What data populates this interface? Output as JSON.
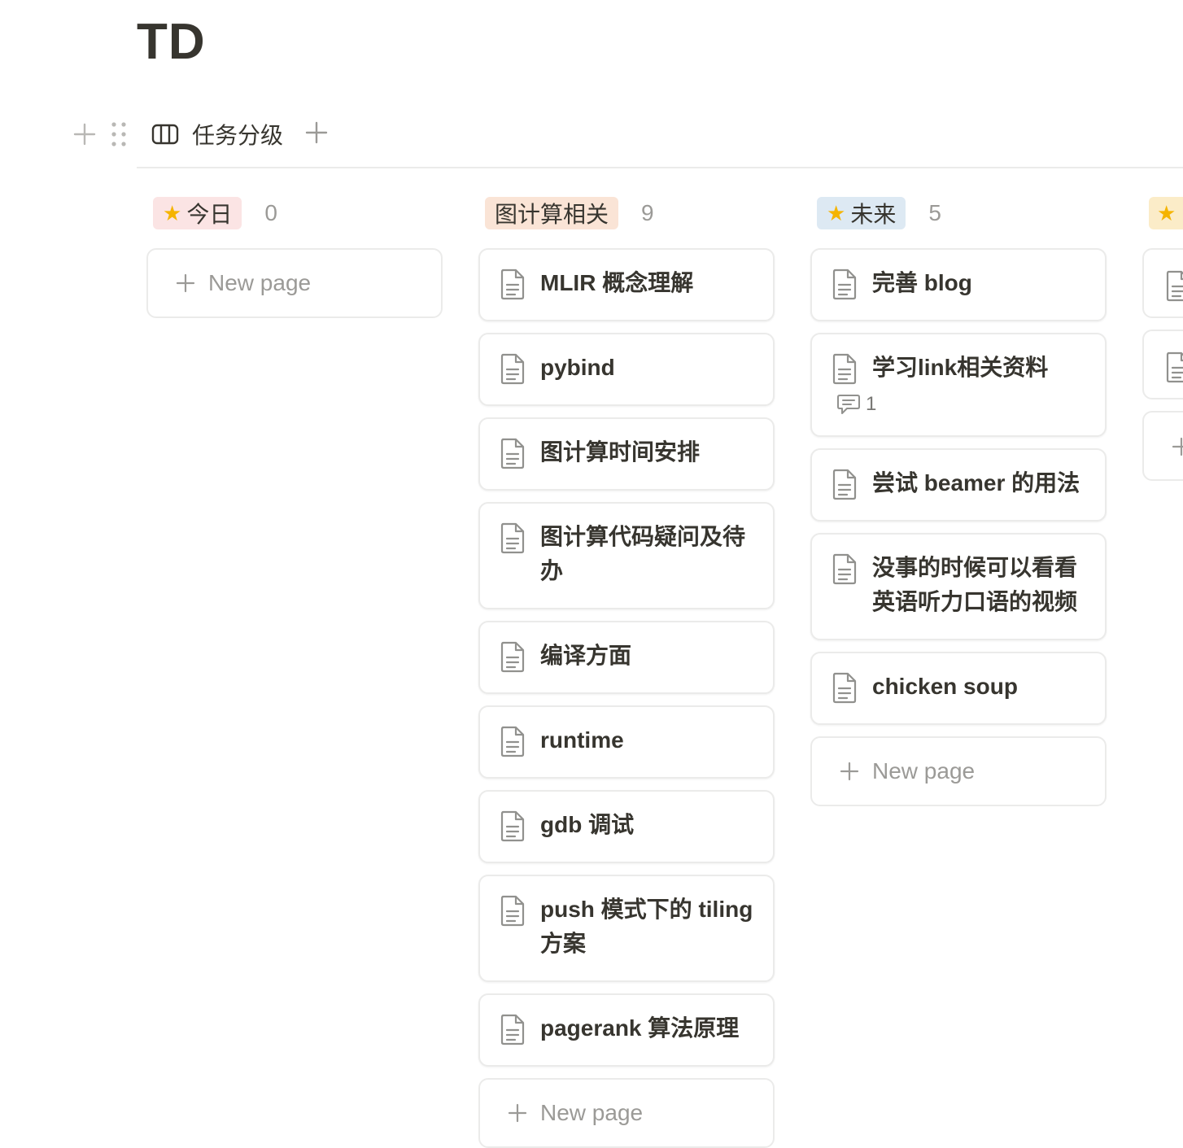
{
  "page": {
    "title": "TD"
  },
  "view": {
    "label": "任务分级"
  },
  "columns": [
    {
      "name": "今日",
      "count": "0",
      "pill_color": "#fbe4e4",
      "starred": true,
      "cards": [],
      "new_label": "New page"
    },
    {
      "name": "图计算相关",
      "count": "9",
      "pill_color": "#fae4d6",
      "starred": false,
      "cards": [
        {
          "title": "MLIR 概念理解"
        },
        {
          "title": "pybind"
        },
        {
          "title": "图计算时间安排"
        },
        {
          "title": "图计算代码疑问及待办"
        },
        {
          "title": "编译方面"
        },
        {
          "title": "runtime"
        },
        {
          "title": "gdb 调试"
        },
        {
          "title": "push 模式下的 tiling 方案"
        },
        {
          "title": "pagerank 算法原理"
        }
      ],
      "new_label": "New page"
    },
    {
      "name": "未来",
      "count": "5",
      "pill_color": "#dde9f3",
      "starred": true,
      "cards": [
        {
          "title": "完善 blog"
        },
        {
          "title": "学习link相关资料",
          "comments": "1"
        },
        {
          "title": "尝试 beamer 的用法"
        },
        {
          "title": "没事的时候可以看看英语听力口语的视频"
        },
        {
          "title": "chicken soup"
        }
      ],
      "new_label": "New page"
    },
    {
      "name": "",
      "count": "",
      "pill_color": "#fbecc8",
      "starred": true,
      "cards": [
        {
          "title": ""
        },
        {
          "title": ""
        }
      ],
      "new_label": ""
    }
  ],
  "icons": {
    "view": "board-view-icon",
    "card": "document-icon",
    "comment": "comment-icon",
    "add": "plus-icon",
    "drag": "drag-handle-icon",
    "star": "star-icon"
  }
}
